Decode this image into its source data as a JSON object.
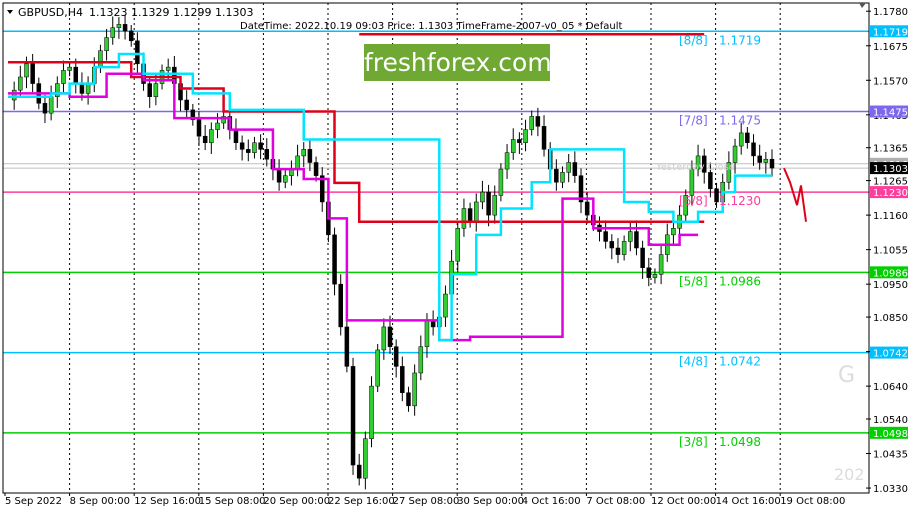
{
  "header": {
    "symbol": "GBPUSD,H4",
    "ohlc": "1.1323 1.1329 1.1299 1.1303",
    "crosshair_info": "DateTime: 2022.10.19 09:03    Price: 1.1303    TimeFrame-2007-v0_05    *    Default"
  },
  "brand": {
    "text": "freshforex.com",
    "color": "#6fa832"
  },
  "watermarks": {
    "symbol_fragment": "G",
    "year_fragment": "202"
  },
  "chart_data": {
    "type": "candlestick",
    "title": "GBPUSD,H4",
    "ylim": [
      1.0315,
      1.1805
    ],
    "y_ticks": [
      "1.1780",
      "1.1675",
      "1.1570",
      "1.1465",
      "1.1365",
      "1.1265",
      "1.1160",
      "1.1055",
      "1.0950",
      "1.0850",
      "1.0745",
      "1.0640",
      "1.0540",
      "1.0435",
      "1.0330"
    ],
    "x_ticks": [
      "5 Sep 2022",
      "8 Sep 00:00",
      "12 Sep 16:00",
      "15 Sep 08:00",
      "20 Sep 00:00",
      "22 Sep 16:00",
      "27 Sep 08:00",
      "30 Sep 00:00",
      "4 Oct 16:00",
      "7 Oct 08:00",
      "12 Oct 00:00",
      "14 Oct 16:00",
      "19 Oct 08:00"
    ],
    "price_tags": [
      {
        "value": 1.1719,
        "label": "1.1719",
        "color": "#00bfff"
      },
      {
        "value": 1.1475,
        "label": "1.1475",
        "color": "#7b68ee"
      },
      {
        "value": 1.1316,
        "label": "1.1316",
        "color": "#b0b0b0"
      },
      {
        "value": 1.1303,
        "label": "1.1303",
        "color": "#000000"
      },
      {
        "value": 1.123,
        "label": "1.1230",
        "color": "#ff3d9a"
      },
      {
        "value": 1.0986,
        "label": "1.0986",
        "color": "#00d000"
      },
      {
        "value": 1.0742,
        "label": "1.0742",
        "color": "#00bfff"
      },
      {
        "value": 1.0498,
        "label": "1.0498",
        "color": "#00d000"
      }
    ],
    "murrey_levels": [
      {
        "name": "[8/8]",
        "value": "1.1719",
        "level": 1.1719,
        "color": "#00bfff"
      },
      {
        "name": "[7/8]",
        "value": "1.1475",
        "level": 1.1475,
        "color": "#7b68ee"
      },
      {
        "name": "[6/8]",
        "value": "1.1230",
        "level": 1.123,
        "color": "#ff3d9a"
      },
      {
        "name": "[5/8]",
        "value": "1.0986",
        "level": 1.0986,
        "color": "#00d000"
      },
      {
        "name": "[4/8]",
        "value": "1.0742",
        "level": 1.0742,
        "color": "#00bfff"
      },
      {
        "name": "[3/8]",
        "value": "1.0498",
        "level": 1.0498,
        "color": "#00d000"
      }
    ],
    "faint_label": "Yesterday Close",
    "price_series": [
      1.151,
      1.154,
      1.158,
      1.162,
      1.156,
      1.15,
      1.147,
      1.152,
      1.156,
      1.16,
      1.161,
      1.156,
      1.153,
      1.156,
      1.161,
      1.166,
      1.17,
      1.173,
      1.174,
      1.172,
      1.169,
      1.162,
      1.156,
      1.152,
      1.156,
      1.16,
      1.161,
      1.156,
      1.151,
      1.148,
      1.145,
      1.14,
      1.138,
      1.142,
      1.144,
      1.146,
      1.142,
      1.138,
      1.136,
      1.135,
      1.138,
      1.136,
      1.133,
      1.13,
      1.126,
      1.128,
      1.13,
      1.134,
      1.136,
      1.132,
      1.128,
      1.12,
      1.11,
      1.095,
      1.082,
      1.07,
      1.04,
      1.036,
      1.048,
      1.064,
      1.075,
      1.082,
      1.076,
      1.07,
      1.062,
      1.058,
      1.068,
      1.076,
      1.084,
      1.082,
      1.085,
      1.092,
      1.102,
      1.112,
      1.118,
      1.114,
      1.12,
      1.123,
      1.116,
      1.122,
      1.13,
      1.135,
      1.139,
      1.138,
      1.142,
      1.146,
      1.143,
      1.136,
      1.13,
      1.126,
      1.129,
      1.132,
      1.128,
      1.12,
      1.116,
      1.113,
      1.111,
      1.108,
      1.106,
      1.104,
      1.108,
      1.111,
      1.106,
      1.1,
      1.097,
      1.098,
      1.104,
      1.11,
      1.112,
      1.116,
      1.122,
      1.13,
      1.134,
      1.129,
      1.124,
      1.12,
      1.126,
      1.132,
      1.137,
      1.141,
      1.138,
      1.134,
      1.132,
      1.133,
      1.1303
    ],
    "red_step_line": [
      [
        0,
        1.1625
      ],
      [
        20,
        1.1625
      ],
      [
        20,
        1.158
      ],
      [
        28,
        1.158
      ],
      [
        28,
        1.1545
      ],
      [
        35,
        1.1545
      ],
      [
        35,
        1.1475
      ],
      [
        53,
        1.1475
      ],
      [
        53,
        1.1258
      ],
      [
        57,
        1.1258
      ],
      [
        57,
        1.114
      ],
      [
        113,
        1.114
      ]
    ],
    "red_top_line": [
      [
        57,
        1.171
      ],
      [
        113,
        1.171
      ]
    ],
    "magenta_line": [
      1.153,
      1.153,
      1.153,
      1.153,
      1.153,
      1.152,
      1.151,
      1.151,
      1.152,
      1.153,
      1.153,
      1.153,
      1.152,
      1.152,
      1.152,
      1.153,
      1.156,
      1.158,
      1.16,
      1.16,
      1.16,
      1.159,
      1.157,
      1.156,
      1.156,
      1.156,
      1.154,
      1.151,
      1.147,
      1.146,
      1.144,
      1.142,
      1.142,
      1.142,
      1.141,
      1.14,
      1.139,
      1.137,
      1.135,
      1.133,
      1.133,
      1.133,
      1.13,
      1.13,
      1.129,
      1.129,
      1.129,
      1.128,
      1.127,
      1.124,
      1.12,
      1.11,
      1.096,
      1.086,
      1.084,
      1.084,
      1.084,
      1.084,
      1.084,
      1.08,
      1.078,
      1.078,
      1.078,
      1.078,
      1.078,
      1.078,
      1.078,
      1.078,
      1.078,
      1.078,
      1.078,
      1.078,
      1.078,
      1.078,
      1.078,
      1.078,
      1.078,
      1.078,
      1.078,
      1.078,
      1.078,
      1.078,
      1.078,
      1.078,
      1.078,
      1.078,
      1.078,
      1.078,
      1.078,
      1.078,
      1.078,
      1.078,
      1.078,
      1.078,
      1.078,
      1.078,
      1.078,
      1.078,
      1.078,
      1.078,
      1.078,
      1.078,
      1.078,
      1.078,
      1.078,
      1.078,
      1.078,
      1.078,
      1.078,
      1.078,
      1.078,
      1.078,
      1.078,
      1.078,
      1.078,
      1.078,
      1.078,
      1.078,
      1.078,
      1.078,
      1.078,
      1.078,
      1.078,
      1.078,
      1.078
    ],
    "magenta_line_values": [
      [
        0,
        1.153
      ],
      [
        10,
        1.152
      ],
      [
        16,
        1.159
      ],
      [
        22,
        1.157
      ],
      [
        27,
        1.1455
      ],
      [
        36,
        1.142
      ],
      [
        43,
        1.13
      ],
      [
        48,
        1.127
      ],
      [
        52,
        1.115
      ],
      [
        55,
        1.084
      ],
      [
        70,
        1.078
      ],
      [
        75,
        1.079
      ],
      [
        90,
        1.121
      ],
      [
        95,
        1.112
      ],
      [
        104,
        1.107
      ],
      [
        109,
        1.11
      ]
    ],
    "cyan_line": [
      [
        0,
        1.152
      ],
      [
        7,
        1.153
      ],
      [
        10,
        1.156
      ],
      [
        14,
        1.161
      ],
      [
        18,
        1.165
      ],
      [
        22,
        1.159
      ],
      [
        30,
        1.153
      ],
      [
        36,
        1.148
      ],
      [
        48,
        1.139
      ],
      [
        70,
        1.078
      ],
      [
        72,
        1.098
      ],
      [
        76,
        1.11
      ],
      [
        80,
        1.118
      ],
      [
        85,
        1.126
      ],
      [
        88,
        1.136
      ],
      [
        97,
        1.136
      ],
      [
        100,
        1.12
      ],
      [
        104,
        1.117
      ],
      [
        108,
        1.114
      ],
      [
        112,
        1.117
      ],
      [
        116,
        1.123
      ],
      [
        118,
        1.128
      ],
      [
        124,
        1.128
      ]
    ],
    "forecast": [
      [
        124,
        1.1303
      ],
      [
        125,
        1.126
      ],
      [
        126,
        1.119
      ],
      [
        127,
        1.125
      ],
      [
        128,
        1.114
      ]
    ]
  }
}
